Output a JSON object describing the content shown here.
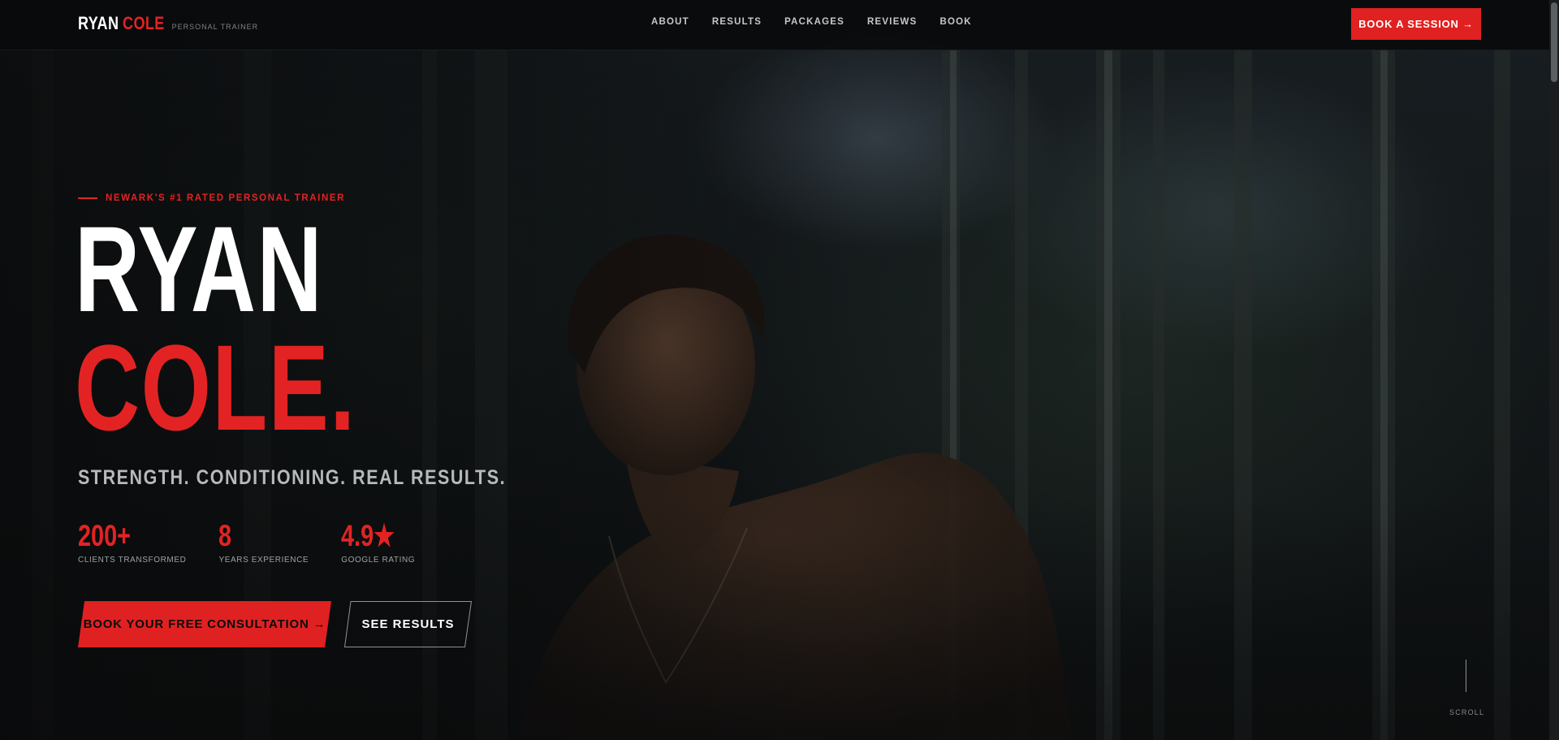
{
  "brand": {
    "first_name": "RYAN",
    "last_name": "COLE",
    "tagline": "PERSONAL TRAINER"
  },
  "nav": {
    "links": [
      {
        "label": "ABOUT"
      },
      {
        "label": "RESULTS"
      },
      {
        "label": "PACKAGES"
      },
      {
        "label": "REVIEWS"
      },
      {
        "label": "BOOK"
      }
    ],
    "cta_label": "BOOK A SESSION →"
  },
  "hero": {
    "eyebrow": "NEWARK'S #1 RATED PERSONAL TRAINER",
    "title_line_1": "RYAN",
    "title_line_2": "COLE.",
    "tagline": "STRENGTH. CONDITIONING. REAL RESULTS.",
    "stats": [
      {
        "value": "200+",
        "label": "CLIENTS TRANSFORMED"
      },
      {
        "value": "8",
        "label": "YEARS EXPERIENCE"
      },
      {
        "value": "4.9★",
        "label": "GOOGLE RATING"
      }
    ],
    "primary_cta": "BOOK YOUR FREE CONSULTATION →",
    "secondary_cta": "SEE RESULTS",
    "background_image": "shirtless-man-in-forest-photo"
  },
  "scroll_indicator": {
    "label": "SCROLL"
  },
  "colors": {
    "accent": "#e32323",
    "background": "#0d0f10",
    "text": "#ffffff",
    "muted": "#9ea2a4"
  }
}
